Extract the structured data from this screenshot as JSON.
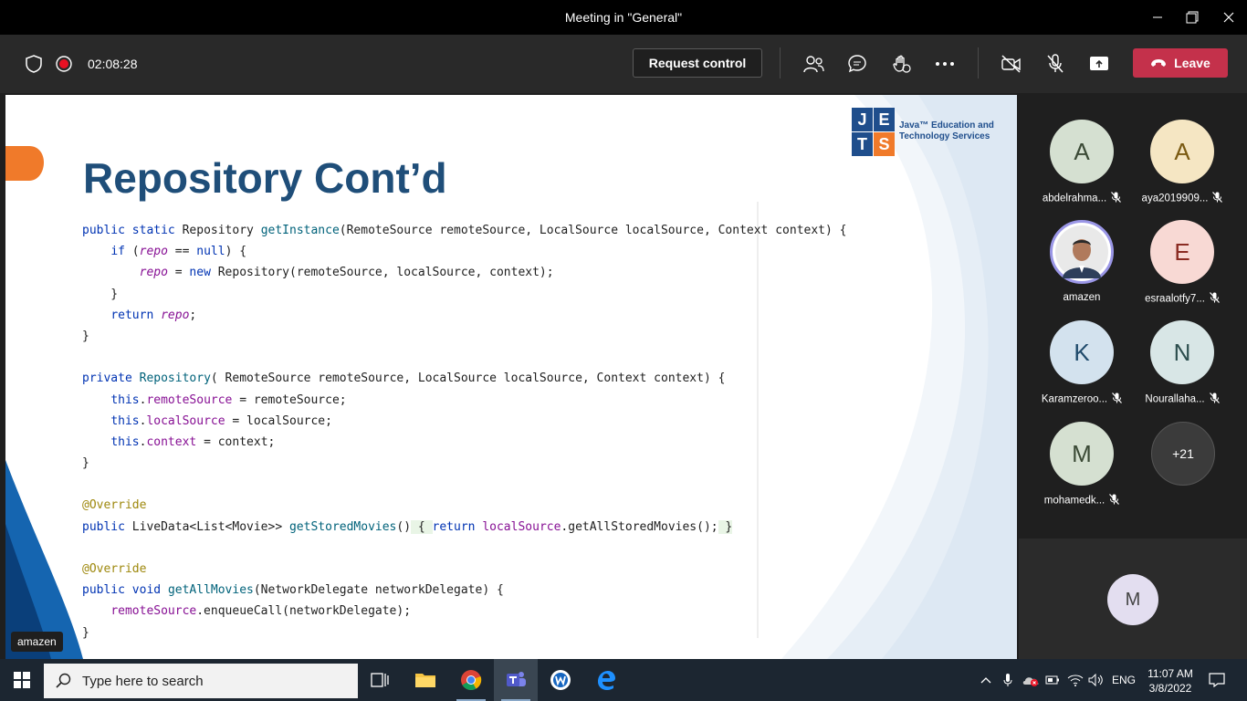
{
  "window": {
    "title": "Meeting in \"General\""
  },
  "toolbar": {
    "timer": "02:08:28",
    "request_control_label": "Request control",
    "leave_label": "Leave",
    "colors": {
      "leave": "#c4314b",
      "recording": "#e81123"
    }
  },
  "slide": {
    "title": "Repository Cont’d",
    "logo": {
      "letters": [
        "J",
        "E",
        "T",
        "S"
      ],
      "text_line1": "Java™ Education and",
      "text_line2": "Technology Services"
    },
    "presenter_tag": "amazen"
  },
  "code_lines": [
    "public static Repository getInstance(RemoteSource remoteSource, LocalSource localSource, Context context) {",
    "    if (repo == null) {",
    "        repo = new Repository(remoteSource, localSource, context);",
    "    }",
    "    return repo;",
    "}",
    "",
    "private Repository( RemoteSource remoteSource, LocalSource localSource, Context context) {",
    "    this.remoteSource = remoteSource;",
    "    this.localSource = localSource;",
    "    this.context = context;",
    "}",
    "",
    "@Override",
    "public LiveData<List<Movie>> getStoredMovies() { return localSource.getAllStoredMovies(); }",
    "",
    "@Override",
    "public void getAllMovies(NetworkDelegate networkDelegate) {",
    "    remoteSource.enqueueCall(networkDelegate);",
    "}"
  ],
  "participants": [
    {
      "initial": "A",
      "name": "abdelrahma...",
      "muted": true,
      "bg": "#d5e0d1",
      "fg": "#3b4a36"
    },
    {
      "initial": "A",
      "name": "aya2019909...",
      "muted": true,
      "bg": "#f5e6c3",
      "fg": "#7a5a12"
    },
    {
      "initial": "",
      "name": "amazen",
      "muted": false,
      "bg": "#c8c6f0",
      "fg": "#333"
    },
    {
      "initial": "E",
      "name": "esraalotfy7...",
      "muted": true,
      "bg": "#f8d9d4",
      "fg": "#8a2b22"
    },
    {
      "initial": "K",
      "name": "Karamzeroo...",
      "muted": true,
      "bg": "#d3e2ee",
      "fg": "#1f4a6b"
    },
    {
      "initial": "N",
      "name": "Nourallaha...",
      "muted": true,
      "bg": "#d8e6e6",
      "fg": "#2c4d4d"
    },
    {
      "initial": "M",
      "name": "mohamedk...",
      "muted": true,
      "bg": "#d5e0d1",
      "fg": "#3b4a36"
    }
  ],
  "overflow_count": "+21",
  "self_avatar_initial": "M",
  "taskbar": {
    "search_placeholder": "Type here to search",
    "language": "ENG",
    "time": "11:07 AM",
    "date": "3/8/2022"
  }
}
